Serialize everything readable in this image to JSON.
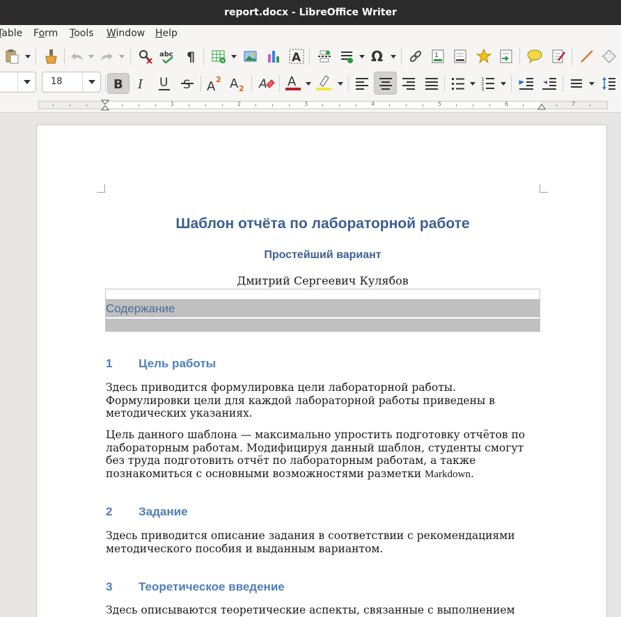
{
  "window": {
    "title": "report.docx - LibreOffice Writer"
  },
  "menu": {
    "items": [
      "Table",
      "Form",
      "Tools",
      "Window",
      "Help"
    ],
    "accel_first": [
      "T",
      "o",
      "T",
      "W",
      "H"
    ]
  },
  "format": {
    "paragraph_style": "",
    "font_size": "18"
  },
  "ruler": {
    "numbers": [
      "1",
      "2",
      "3",
      "4",
      "5",
      "6",
      "7"
    ]
  },
  "document": {
    "title": "Шаблон отчёта по лабораторной работе",
    "subtitle": "Простейший вариант",
    "author": "Дмитрий Сергеевич Кулябов",
    "toc_heading": "Содержание",
    "sections": [
      {
        "number": "1",
        "heading": "Цель работы",
        "paragraphs": [
          "Здесь приводится формулировка цели лабораторной работы. Формулировки цели для каждой лабораторной работы приведены в методических указаниях.",
          "Цель данного шаблона — максимально упростить подготовку отчётов по лабораторным работам. Модифицируя данный шаблон, студенты смогут без труда подготовить отчёт по лабораторным работам, а также познакомиться с основными возможностями разметки "
        ],
        "inline_code": "Markdown",
        "trailing": "."
      },
      {
        "number": "2",
        "heading": "Задание",
        "paragraphs": [
          "Здесь приводится описание задания в соответствии с рекомендациями методического пособия и выданным вариантом."
        ]
      },
      {
        "number": "3",
        "heading": "Теоретическое введение",
        "paragraphs": [
          "Здесь описываются теоретические аспекты, связанные с выполнением"
        ]
      }
    ]
  },
  "colors": {
    "heading": "#4f7fb8",
    "title": "#3d5f93",
    "toc_shade": "#c0c0c0",
    "titlebar": "#2b2b2b"
  }
}
